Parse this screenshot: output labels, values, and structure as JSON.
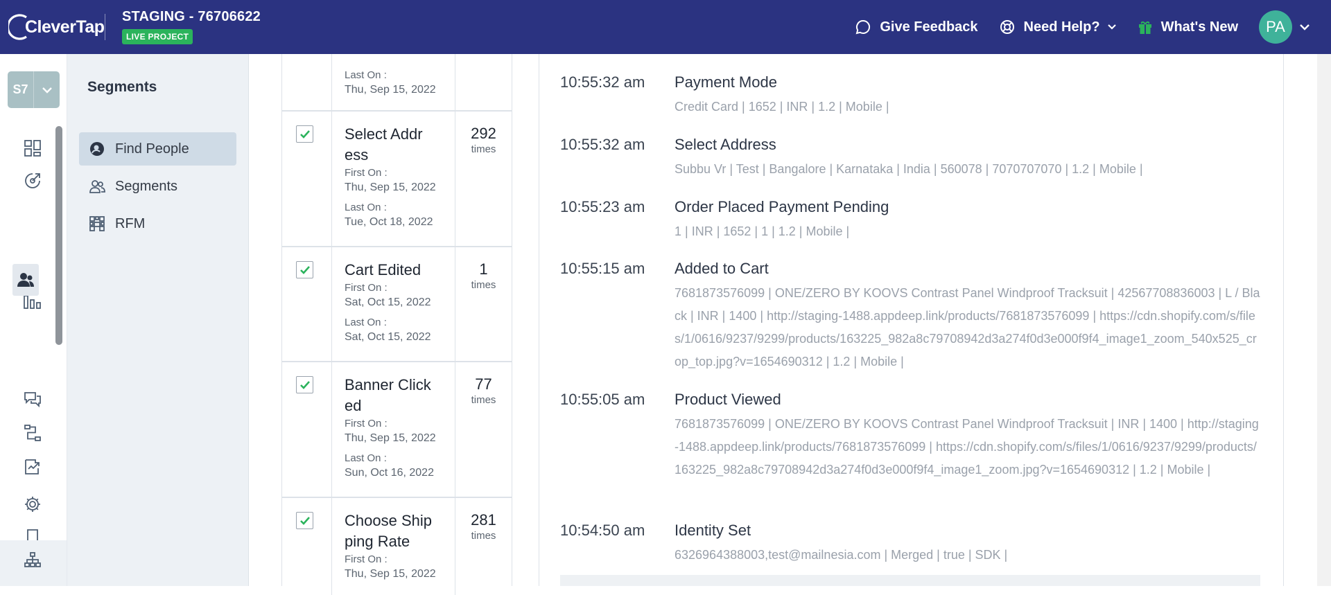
{
  "header": {
    "logo_text": "CleverTap",
    "project_name": "STAGING - 76706622",
    "live_badge": "LIVE PROJECT",
    "feedback_label": "Give Feedback",
    "help_label": "Need Help?",
    "whats_new_label": "What's New",
    "avatar_initials": "PA"
  },
  "account": {
    "code": "S7"
  },
  "subnav": {
    "title": "Segments",
    "items": [
      {
        "label": "Find People",
        "icon": "find-people-icon",
        "active": true
      },
      {
        "label": "Segments",
        "icon": "segments-icon",
        "active": false
      },
      {
        "label": "RFM",
        "icon": "rfm-grid-icon",
        "active": false
      }
    ]
  },
  "events": {
    "partial_top": {
      "last_on_label": "Last On :",
      "last_on": "Thu, Sep 15, 2022"
    },
    "rows": [
      {
        "name": "Select Addr ess",
        "first_on_label": "First On :",
        "first_on": "Thu, Sep 15, 2022",
        "last_on_label": "Last On :",
        "last_on": "Tue, Oct 18, 2022",
        "count": "292",
        "times": "times",
        "checked": true
      },
      {
        "name": "Cart Edited",
        "first_on_label": "First On :",
        "first_on": "Sat, Oct 15, 2022",
        "last_on_label": "Last On :",
        "last_on": "Sat, Oct 15, 2022",
        "count": "1",
        "times": "times",
        "checked": true
      },
      {
        "name": "Banner Click ed",
        "first_on_label": "First On :",
        "first_on": "Thu, Sep 15, 2022",
        "last_on_label": "Last On :",
        "last_on": "Sun, Oct 16, 2022",
        "count": "77",
        "times": "times",
        "checked": true
      },
      {
        "name": "Choose Ship ping Rate",
        "first_on_label": "First On :",
        "first_on": "Thu, Sep 15, 2022",
        "count": "281",
        "times": "times",
        "checked": true
      }
    ]
  },
  "activity": [
    {
      "time": "10:55:32 am",
      "title": "Payment Mode",
      "props": "Credit Card  |  1652  |  INR  |  1.2  |  Mobile  |"
    },
    {
      "time": "10:55:32 am",
      "title": "Select Address",
      "props": "Subbu Vr  |  Test  |  Bangalore  |  Karnataka  |  India  |  560078  |  7070707070  |  1.2  |  Mobile  |"
    },
    {
      "time": "10:55:23 am",
      "title": "Order Placed Payment Pending",
      "props": "1  |  INR  |  1652  |  1  |  1.2  |  Mobile  |"
    },
    {
      "time": "10:55:15 am",
      "title": "Added to Cart",
      "props": "7681873576099  |  ONE/ZERO BY KOOVS Contrast Panel Windproof Tracksuit  |  42567708836003  |  L / Black  |  INR  |  1400  |  http://staging-1488.appdeep.link/products/7681873576099  |  https://cdn.shopify.com/s/files/1/0616/9237/9299/products/163225_982a8c79708942d3a274f0d3e000f9f4_image1_zoom_540x525_crop_top.jpg?v=1654690312  |  1.2  |  Mobile  |"
    },
    {
      "time": "10:55:05 am",
      "title": "Product Viewed",
      "props": "7681873576099  |  ONE/ZERO BY KOOVS Contrast Panel Windproof Tracksuit  |  INR  |  1400  |  http://staging-1488.appdeep.link/products/7681873576099  |  https://cdn.shopify.com/s/files/1/0616/9237/9299/products/163225_982a8c79708942d3a274f0d3e000f9f4_image1_zoom.jpg?v=1654690312  |  1.2  |  Mobile  |"
    },
    {
      "time": "10:54:50 am",
      "title": "Identity Set",
      "props": "6326964388003,test@mailnesia.com  |  Merged  |  true  |  SDK  |"
    }
  ],
  "colors": {
    "header_bg": "#2b3381",
    "live_badge": "#2bb35c",
    "avatar": "#3fb29a",
    "check": "#2bb35c"
  }
}
